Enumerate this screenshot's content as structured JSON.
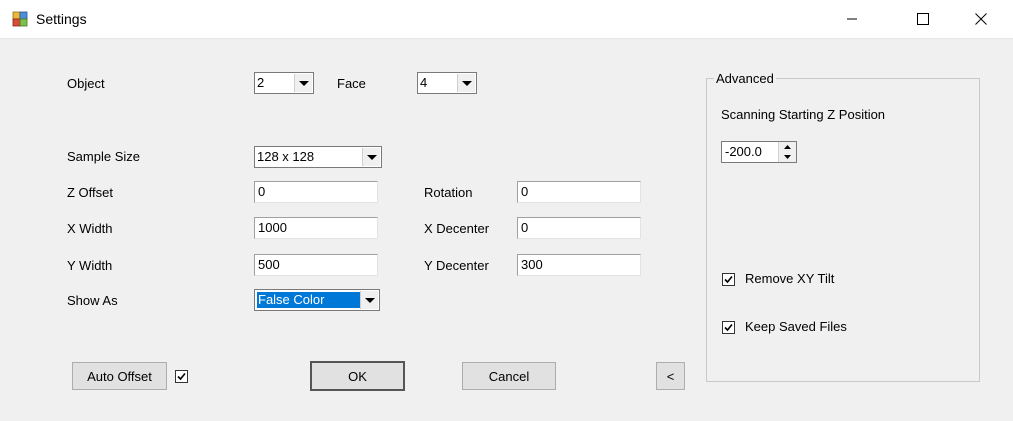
{
  "window": {
    "title": "Settings"
  },
  "form": {
    "object_label": "Object",
    "object_value": "2",
    "face_label": "Face",
    "face_value": "4",
    "sample_size_label": "Sample Size",
    "sample_size_value": "128 x 128",
    "z_offset_label": "Z Offset",
    "z_offset_value": "0",
    "x_width_label": "X Width",
    "x_width_value": "1000",
    "y_width_label": "Y Width",
    "y_width_value": "500",
    "show_as_label": "Show As",
    "show_as_value": "False Color",
    "rotation_label": "Rotation",
    "rotation_value": "0",
    "x_decenter_label": "X Decenter",
    "x_decenter_value": "0",
    "y_decenter_label": "Y Decenter",
    "y_decenter_value": "300"
  },
  "buttons": {
    "auto_offset": "Auto Offset",
    "ok": "OK",
    "cancel": "Cancel",
    "collapse": "<"
  },
  "auto_offset_checked": true,
  "advanced": {
    "title": "Advanced",
    "scan_z_label": "Scanning Starting Z Position",
    "scan_z_value": "-200.0",
    "remove_xy_tilt_label": "Remove XY Tilt",
    "remove_xy_tilt_checked": true,
    "keep_saved_files_label": "Keep Saved Files",
    "keep_saved_files_checked": true
  },
  "colors": {
    "selection_highlight": "#0078d7",
    "window_bg": "#f0f0f0",
    "titlebar_bg": "#ffffff"
  },
  "icons": {
    "app": "app-icon",
    "minimize": "minimize-icon",
    "maximize": "maximize-icon",
    "close": "close-icon",
    "dropdown": "chevron-down-icon",
    "spinner_up": "spinner-up-icon",
    "spinner_down": "spinner-down-icon",
    "check": "check-icon"
  }
}
